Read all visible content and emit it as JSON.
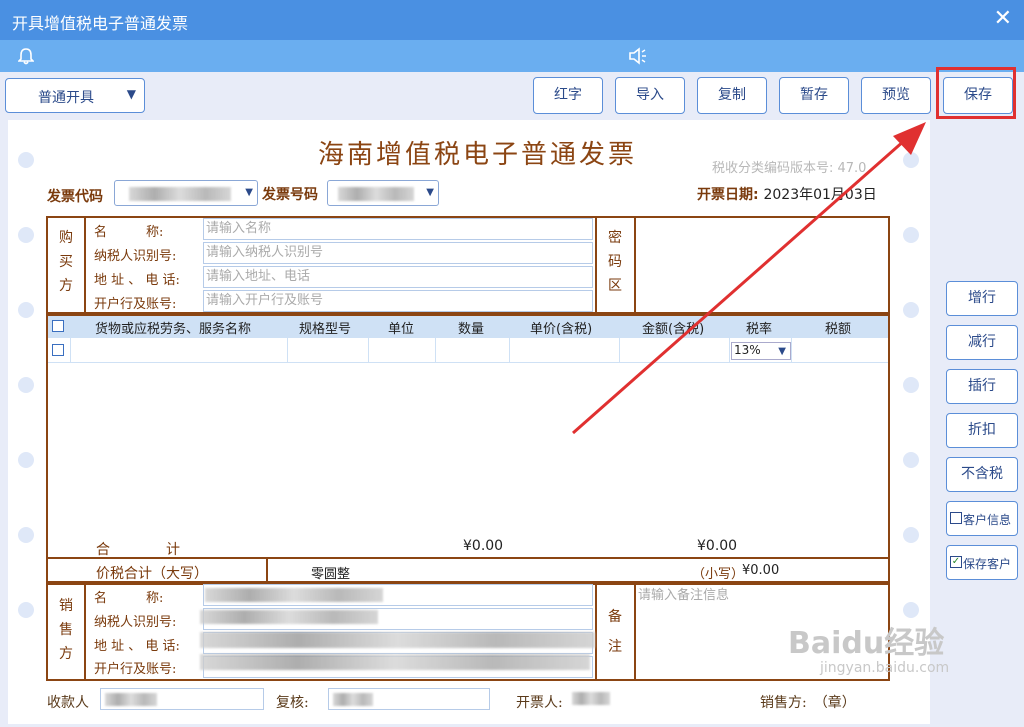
{
  "window": {
    "title": "开具增值税电子普通发票",
    "close_icon": "close-icon"
  },
  "toolbar": {
    "mode_select": "普通开具",
    "buttons": [
      "红字",
      "导入",
      "复制",
      "暂存",
      "预览",
      "保存"
    ]
  },
  "invoice": {
    "title": "海南增值税电子普通发票",
    "version_label": "税收分类编码版本号: 47.0",
    "code_label": "发票代码",
    "number_label": "发票号码",
    "date_label": "开票日期:",
    "date_value": "2023年01月03日",
    "buyer": {
      "side_label": [
        "购",
        "买",
        "方"
      ],
      "fields": [
        {
          "label": "名　　　称:",
          "placeholder": "请输入名称"
        },
        {
          "label": "纳税人识别号:",
          "placeholder": "请输入纳税人识别号"
        },
        {
          "label": "地 址 、 电 话:",
          "placeholder": "请输入地址、电话"
        },
        {
          "label": "开户行及账号:",
          "placeholder": "请输入开户行及账号"
        }
      ],
      "password_label": [
        "密",
        "码",
        "区"
      ]
    },
    "table": {
      "headers": [
        "货物或应税劳务、服务名称",
        "规格型号",
        "单位",
        "数量",
        "单价(含税)",
        "金额(含税)",
        "税率",
        "税额"
      ],
      "rows": [
        {
          "tax_rate": "13%"
        }
      ],
      "total_label": "合　　　　计",
      "total_amount": "¥0.00",
      "total_tax": "¥0.00"
    },
    "price_tax": {
      "label": "价税合计（大写）",
      "upper": "零圆整",
      "lower_label": "（小写）",
      "lower_value": "¥0.00"
    },
    "seller": {
      "side_label": [
        "销",
        "售",
        "方"
      ],
      "fields": [
        "名　　　称:",
        "纳税人识别号:",
        "地 址 、 电 话:",
        "开户行及账号:"
      ],
      "remark_label": [
        "备",
        "注"
      ],
      "remark_placeholder": "请输入备注信息"
    },
    "footer": {
      "payee": "收款人",
      "reviewer": "复核:",
      "drawer": "开票人:",
      "seller_stamp": "销售方:　（章）"
    }
  },
  "side_buttons": [
    "增行",
    "减行",
    "插行",
    "折扣",
    "不含税"
  ],
  "side_checks": [
    {
      "label": "客户信息",
      "checked": false
    },
    {
      "label": "保存客户",
      "checked": true
    }
  ],
  "watermark": {
    "brand": "Baidu经验",
    "url": "jingyan.baidu.com"
  },
  "colors": {
    "title_bar": "#4a90e2",
    "invoice_brown": "#8b4513",
    "highlight": "#e03030"
  }
}
